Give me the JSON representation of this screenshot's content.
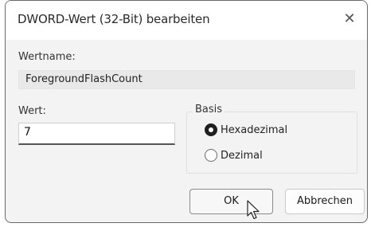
{
  "window": {
    "title": "DWORD-Wert (32-Bit) bearbeiten",
    "close_glyph": "✕"
  },
  "value_name": {
    "label": "Wertname:",
    "value": "ForegroundFlashCount"
  },
  "value_data": {
    "label": "Wert:",
    "value": "7"
  },
  "basis": {
    "label": "Basis",
    "options": [
      {
        "label": "Hexadezimal",
        "selected": true
      },
      {
        "label": "Dezimal",
        "selected": false
      }
    ]
  },
  "buttons": {
    "ok_label": "OK",
    "cancel_label": "Abbrechen"
  },
  "icons": {
    "close": "close-icon",
    "cursor": "mouse-pointer-icon"
  }
}
